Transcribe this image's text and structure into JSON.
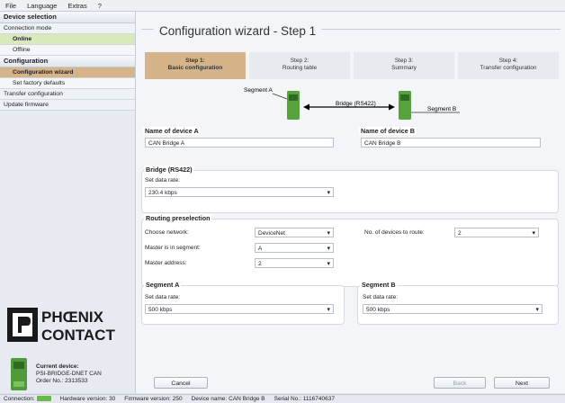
{
  "menu": [
    "File",
    "Language",
    "Extras",
    "?"
  ],
  "sidebar": {
    "device_selection": "Device selection",
    "connection_mode": "Connection mode",
    "online": "Online",
    "offline": "Offline",
    "configuration": "Configuration",
    "configuration_wizard": "Configuration wizard",
    "set_factory_defaults": "Set factory defaults",
    "transfer_configuration": "Transfer configuration",
    "update_firmware": "Update firmware"
  },
  "logo": {
    "line1": "PHŒNIX",
    "line2": "CONTACT"
  },
  "current_device": {
    "heading": "Current device:",
    "name": "PSI-BRIDGE-DNET CAN",
    "order": "Order No.:  2313533"
  },
  "wizard": {
    "title": "Configuration wizard - Step 1",
    "steps": [
      {
        "line1": "Step 1:",
        "line2": "Basic configuration"
      },
      {
        "line1": "Step 2:",
        "line2": "Routing table"
      },
      {
        "line1": "Step 3:",
        "line2": "Summary"
      },
      {
        "line1": "Step 4:",
        "line2": "Transfer configuration"
      }
    ],
    "diagram": {
      "segment_a": "Segment A",
      "bridge": "Bridge (RS422)",
      "segment_b": "Segment B"
    }
  },
  "device_a": {
    "title": "Name of device A",
    "value": "CAN Bridge A"
  },
  "device_b": {
    "title": "Name of device B",
    "value": "CAN Bridge B"
  },
  "bridge": {
    "title": "Bridge (RS422)",
    "label": "Set data rate:",
    "value": "230.4 kbps"
  },
  "routing": {
    "title": "Routing preselection",
    "network_label": "Choose network:",
    "network_value": "DeviceNet",
    "master_seg_label": "Master is in segment:",
    "master_seg_value": "A",
    "master_addr_label": "Master address:",
    "master_addr_value": "2",
    "devices_label": "No. of devices to route:",
    "devices_value": "2"
  },
  "segment_a": {
    "title": "Segment A",
    "label": "Set data rate:",
    "value": "500 kbps"
  },
  "segment_b": {
    "title": "Segment B",
    "label": "Set data rate:",
    "value": "500 kbps"
  },
  "buttons": {
    "cancel": "Cancel",
    "back": "Back",
    "next": "Next"
  },
  "status": {
    "connection": "Connection:",
    "hardware": "Hardware version:  30",
    "firmware": "Firmware version:  250",
    "device_name": "Device name:  CAN Bridge B",
    "serial": "Serial No.:  1116740637"
  }
}
